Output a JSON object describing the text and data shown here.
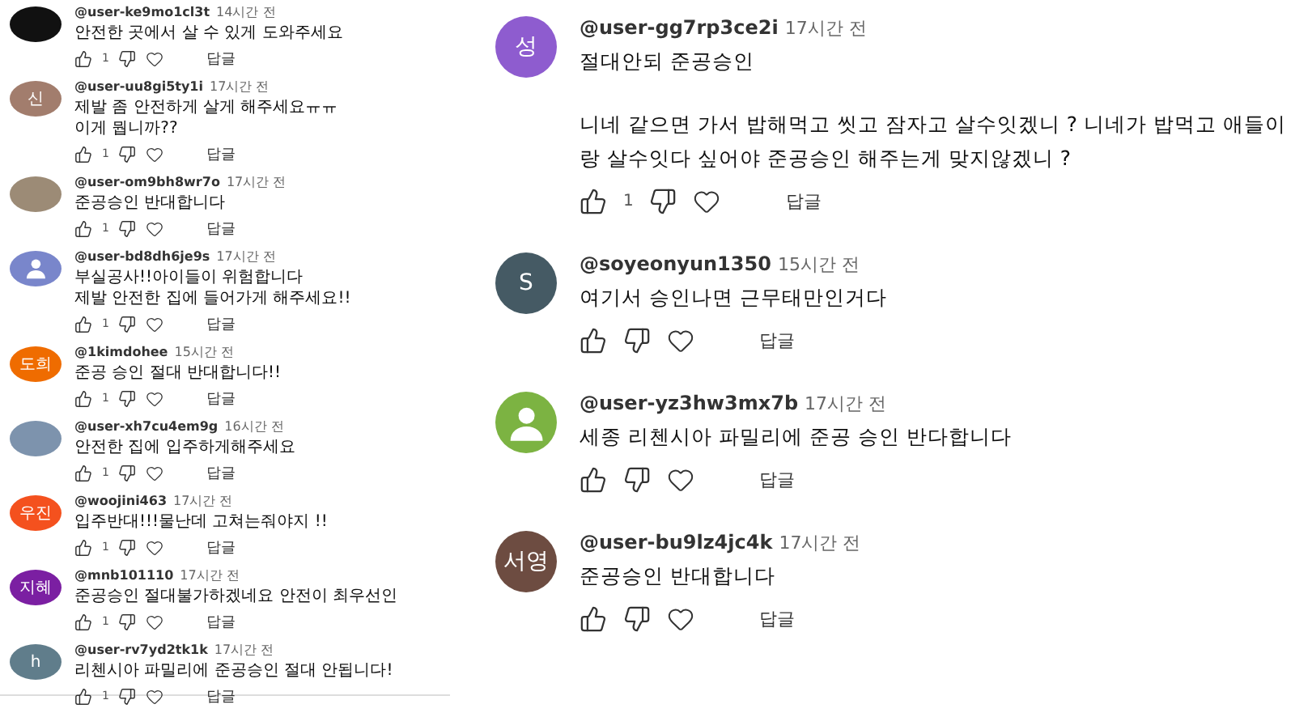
{
  "left_panel": {
    "comments": [
      {
        "author": "@user-ke9mo1cl3t",
        "time": "14시간 전",
        "lines": [
          "안전한 곳에서 살 수 있게 도와주세요"
        ],
        "likes": "1",
        "reply_label": "답글",
        "avatar": {
          "kind": "photo",
          "color": "#111111"
        }
      },
      {
        "author": "@user-uu8gi5ty1i",
        "time": "17시간 전",
        "lines": [
          "제발 좀 안전하게 살게 해주세요ㅠㅠ",
          "이게 뭡니까??"
        ],
        "likes": "1",
        "reply_label": "답글",
        "avatar": {
          "kind": "letter",
          "letter": "신",
          "color": "#a27d6d"
        }
      },
      {
        "author": "@user-om9bh8wr7o",
        "time": "17시간 전",
        "lines": [
          "준공승인 반대합니다"
        ],
        "likes": "1",
        "reply_label": "답글",
        "avatar": {
          "kind": "photo",
          "color": "#9c8b76"
        }
      },
      {
        "author": "@user-bd8dh6je9s",
        "time": "17시간 전",
        "lines": [
          "부실공사!!아이들이 위험합니다",
          "제발 안전한 집에 들어가게 해주세요!!"
        ],
        "likes": "1",
        "reply_label": "답글",
        "avatar": {
          "kind": "silhouette",
          "color": "#7986cb"
        }
      },
      {
        "author": "@1kimdohee",
        "time": "15시간 전",
        "lines": [
          "준공 승인 절대 반대합니다!!"
        ],
        "likes": "1",
        "reply_label": "답글",
        "avatar": {
          "kind": "letter",
          "letter": "도희",
          "color": "#ef6c00"
        }
      },
      {
        "author": "@user-xh7cu4em9g",
        "time": "16시간 전",
        "lines": [
          "안전한 집에 입주하게해주세요"
        ],
        "likes": "1",
        "reply_label": "답글",
        "avatar": {
          "kind": "photo",
          "color": "#7d93ad"
        }
      },
      {
        "author": "@woojini463",
        "time": "17시간 전",
        "lines": [
          "입주반대!!!물난데 고쳐는줘야지 !!"
        ],
        "likes": "1",
        "reply_label": "답글",
        "avatar": {
          "kind": "letter",
          "letter": "우진",
          "color": "#f4511e"
        }
      },
      {
        "author": "@mnb101110",
        "time": "17시간 전",
        "lines": [
          "준공승인 절대불가하겠네요 안전이 최우선인"
        ],
        "likes": "1",
        "reply_label": "답글",
        "avatar": {
          "kind": "letter",
          "letter": "지혜",
          "color": "#7b1fa2"
        }
      },
      {
        "author": "@user-rv7yd2tk1k",
        "time": "17시간 전",
        "lines": [
          "리첸시아 파밀리에 준공승인 절대 안됩니다!"
        ],
        "likes": "1",
        "reply_label": "답글",
        "avatar": {
          "kind": "letter",
          "letter": "h",
          "color": "#607d8b"
        }
      }
    ]
  },
  "right_panel": {
    "comments": [
      {
        "author": "@user-gg7rp3ce2i",
        "time": "17시간 전",
        "lines": [
          "절대안되 준공승인",
          "니네 같으면 가서  밥해먹고 씻고 잠자고 살수잇겠니 ? 니네가 밥먹고 애들이랑 살수잇다 싶어야 준공승인 해주는게 맞지않겠니 ?"
        ],
        "likes": "1",
        "reply_label": "답글",
        "avatar": {
          "kind": "letter",
          "letter": "성",
          "color": "#8e5ccf"
        }
      },
      {
        "author": "@soyeonyun1350",
        "time": "15시간 전",
        "lines": [
          "여기서 승인나면 근무태만인거다"
        ],
        "reply_label": "답글",
        "avatar": {
          "kind": "letter",
          "letter": "S",
          "color": "#455a64"
        }
      },
      {
        "author": "@user-yz3hw3mx7b",
        "time": "17시간 전",
        "lines": [
          "세종 리첸시아 파밀리에 준공 승인 반다합니다"
        ],
        "reply_label": "답글",
        "avatar": {
          "kind": "silhouette",
          "color": "#7cb342"
        }
      },
      {
        "author": "@user-bu9lz4jc4k",
        "time": "17시간 전",
        "lines": [
          "준공승인 반대합니다"
        ],
        "reply_label": "답글",
        "avatar": {
          "kind": "letter",
          "letter": "서영",
          "color": "#6d4c41"
        }
      }
    ]
  }
}
